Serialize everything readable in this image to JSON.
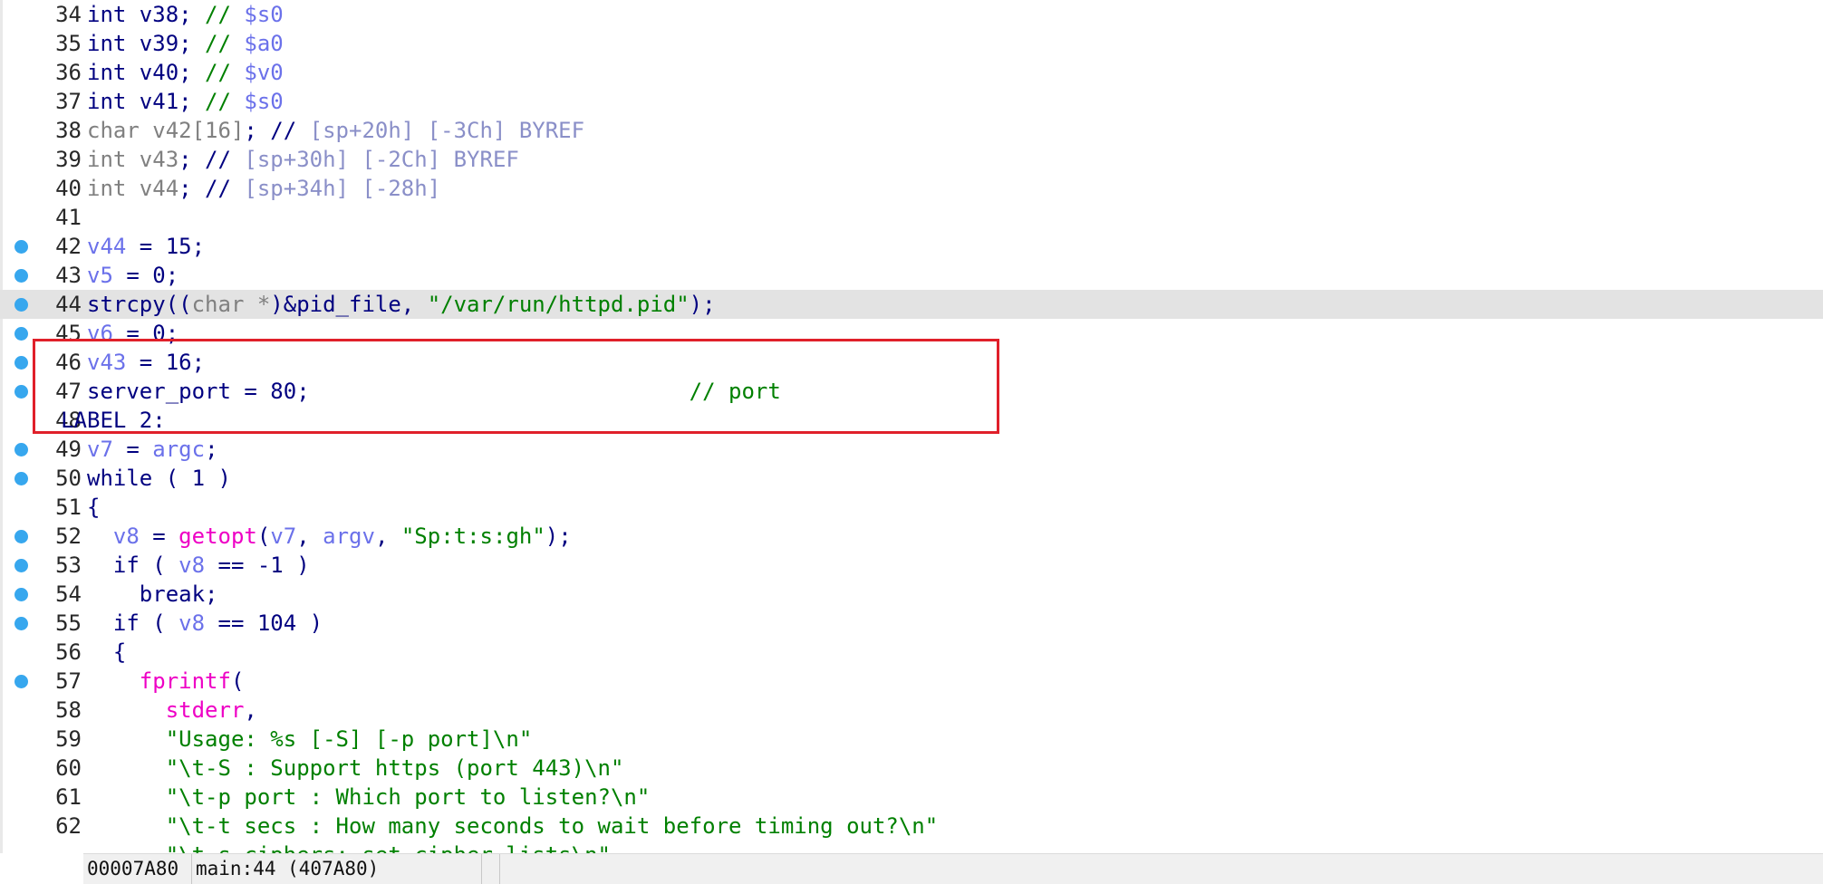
{
  "editor": {
    "lines": [
      {
        "num": "34",
        "dot": false,
        "hl": false,
        "indent": "",
        "tokens": [
          {
            "t": "int v38; ",
            "c": "kw"
          },
          {
            "t": "// ",
            "c": "cmt"
          },
          {
            "t": "$s0",
            "c": "reg"
          }
        ]
      },
      {
        "num": "35",
        "dot": false,
        "hl": false,
        "indent": "",
        "tokens": [
          {
            "t": "int v39; ",
            "c": "kw"
          },
          {
            "t": "// ",
            "c": "cmt"
          },
          {
            "t": "$a0",
            "c": "reg"
          }
        ]
      },
      {
        "num": "36",
        "dot": false,
        "hl": false,
        "indent": "",
        "tokens": [
          {
            "t": "int v40; ",
            "c": "kw"
          },
          {
            "t": "// ",
            "c": "cmt"
          },
          {
            "t": "$v0",
            "c": "reg"
          }
        ]
      },
      {
        "num": "37",
        "dot": false,
        "hl": false,
        "indent": "",
        "tokens": [
          {
            "t": "int v41; ",
            "c": "kw"
          },
          {
            "t": "// ",
            "c": "cmt"
          },
          {
            "t": "$s0",
            "c": "reg"
          }
        ]
      },
      {
        "num": "38",
        "dot": false,
        "hl": false,
        "indent": "",
        "tokens": [
          {
            "t": "char v42",
            "c": "decl"
          },
          {
            "t": "[16]",
            "c": "decl"
          },
          {
            "t": "; // ",
            "c": "kw"
          },
          {
            "t": "[sp+20h] [-3Ch] BYREF",
            "c": "faded"
          }
        ]
      },
      {
        "num": "39",
        "dot": false,
        "hl": false,
        "indent": "",
        "tokens": [
          {
            "t": "int v43",
            "c": "decl"
          },
          {
            "t": "; // ",
            "c": "kw"
          },
          {
            "t": "[sp+30h] [-2Ch] BYREF",
            "c": "faded"
          }
        ]
      },
      {
        "num": "40",
        "dot": false,
        "hl": false,
        "indent": "",
        "tokens": [
          {
            "t": "int v44",
            "c": "decl"
          },
          {
            "t": "; // ",
            "c": "kw"
          },
          {
            "t": "[sp+34h] [-28h]",
            "c": "faded"
          }
        ]
      },
      {
        "num": "41",
        "dot": false,
        "hl": false,
        "indent": "",
        "tokens": []
      },
      {
        "num": "42",
        "dot": true,
        "hl": false,
        "indent": "",
        "tokens": [
          {
            "t": "v44",
            "c": "var"
          },
          {
            "t": " = 15;",
            "c": "plain"
          }
        ]
      },
      {
        "num": "43",
        "dot": true,
        "hl": false,
        "indent": "",
        "tokens": [
          {
            "t": "v5",
            "c": "var"
          },
          {
            "t": " = 0;",
            "c": "plain"
          }
        ]
      },
      {
        "num": "44",
        "dot": true,
        "hl": true,
        "indent": "",
        "tokens": [
          {
            "t": "strcpy((",
            "c": "plain"
          },
          {
            "t": "char *",
            "c": "cast"
          },
          {
            "t": ")&pid_file, ",
            "c": "plain"
          },
          {
            "t": "\"/var/run/httpd.pid\"",
            "c": "str"
          },
          {
            "t": ");",
            "c": "plain"
          }
        ]
      },
      {
        "num": "45",
        "dot": true,
        "hl": false,
        "indent": "",
        "tokens": [
          {
            "t": "v6",
            "c": "var"
          },
          {
            "t": " = 0;",
            "c": "plain"
          }
        ]
      },
      {
        "num": "46",
        "dot": true,
        "hl": false,
        "indent": "",
        "tokens": [
          {
            "t": "v43",
            "c": "var"
          },
          {
            "t": " = 16;",
            "c": "plain"
          }
        ]
      },
      {
        "num": "47",
        "dot": true,
        "hl": false,
        "indent": "",
        "tokens": [
          {
            "t": "server_port = 80;                             ",
            "c": "plain"
          },
          {
            "t": "// port",
            "c": "cmt"
          }
        ]
      },
      {
        "num": "48",
        "dot": false,
        "hl": false,
        "indent": "label",
        "tokens": [
          {
            "t": "LABEL_2:",
            "c": "lbl"
          }
        ]
      },
      {
        "num": "49",
        "dot": true,
        "hl": false,
        "indent": "",
        "tokens": [
          {
            "t": "v7",
            "c": "var"
          },
          {
            "t": " = ",
            "c": "plain"
          },
          {
            "t": "argc",
            "c": "var"
          },
          {
            "t": ";",
            "c": "plain"
          }
        ]
      },
      {
        "num": "50",
        "dot": true,
        "hl": false,
        "indent": "",
        "tokens": [
          {
            "t": "while ( 1 )",
            "c": "plain"
          }
        ]
      },
      {
        "num": "51",
        "dot": false,
        "hl": false,
        "indent": "",
        "tokens": [
          {
            "t": "{",
            "c": "plain"
          }
        ]
      },
      {
        "num": "52",
        "dot": true,
        "hl": false,
        "indent": "  ",
        "tokens": [
          {
            "t": "v8",
            "c": "var"
          },
          {
            "t": " = ",
            "c": "plain"
          },
          {
            "t": "getopt",
            "c": "func"
          },
          {
            "t": "(",
            "c": "plain"
          },
          {
            "t": "v7",
            "c": "var"
          },
          {
            "t": ", ",
            "c": "plain"
          },
          {
            "t": "argv",
            "c": "var"
          },
          {
            "t": ", ",
            "c": "plain"
          },
          {
            "t": "\"Sp:t:s:gh\"",
            "c": "str"
          },
          {
            "t": ");",
            "c": "plain"
          }
        ]
      },
      {
        "num": "53",
        "dot": true,
        "hl": false,
        "indent": "  ",
        "tokens": [
          {
            "t": "if ( ",
            "c": "plain"
          },
          {
            "t": "v8",
            "c": "var"
          },
          {
            "t": " == -1 )",
            "c": "plain"
          }
        ]
      },
      {
        "num": "54",
        "dot": true,
        "hl": false,
        "indent": "    ",
        "tokens": [
          {
            "t": "break;",
            "c": "plain"
          }
        ]
      },
      {
        "num": "55",
        "dot": true,
        "hl": false,
        "indent": "  ",
        "tokens": [
          {
            "t": "if ( ",
            "c": "plain"
          },
          {
            "t": "v8",
            "c": "var"
          },
          {
            "t": " == 104 )",
            "c": "plain"
          }
        ]
      },
      {
        "num": "56",
        "dot": false,
        "hl": false,
        "indent": "  ",
        "tokens": [
          {
            "t": "{",
            "c": "plain"
          }
        ]
      },
      {
        "num": "57",
        "dot": true,
        "hl": false,
        "indent": "    ",
        "tokens": [
          {
            "t": "fprintf",
            "c": "func"
          },
          {
            "t": "(",
            "c": "plain"
          }
        ]
      },
      {
        "num": "58",
        "dot": false,
        "hl": false,
        "indent": "      ",
        "tokens": [
          {
            "t": "stderr",
            "c": "func"
          },
          {
            "t": ",",
            "c": "plain"
          }
        ]
      },
      {
        "num": "59",
        "dot": false,
        "hl": false,
        "indent": "      ",
        "tokens": [
          {
            "t": "\"Usage: %s [-S] [-p port]\\n\"",
            "c": "str"
          }
        ]
      },
      {
        "num": "60",
        "dot": false,
        "hl": false,
        "indent": "      ",
        "tokens": [
          {
            "t": "\"\\t-S : Support https (port 443)\\n\"",
            "c": "str"
          }
        ]
      },
      {
        "num": "61",
        "dot": false,
        "hl": false,
        "indent": "      ",
        "tokens": [
          {
            "t": "\"\\t-p port : Which port to listen?\\n\"",
            "c": "str"
          }
        ]
      },
      {
        "num": "62",
        "dot": false,
        "hl": false,
        "indent": "      ",
        "tokens": [
          {
            "t": "\"\\t-t secs : How many seconds to wait before timing out?\\n\"",
            "c": "str"
          }
        ]
      },
      {
        "num": "",
        "dot": false,
        "hl": false,
        "indent": "      ",
        "tokens": [
          {
            "t": "\"\\t-s ciphers: set cipher lists\\n\"",
            "c": "str"
          }
        ]
      }
    ]
  },
  "status": {
    "address": "00007A80",
    "location": "main:44 (407A80)"
  },
  "colors": {
    "accent_box": "#e0202a",
    "breakpoint_dot": "#37a7ee",
    "current_line": "#e3e3e3"
  }
}
